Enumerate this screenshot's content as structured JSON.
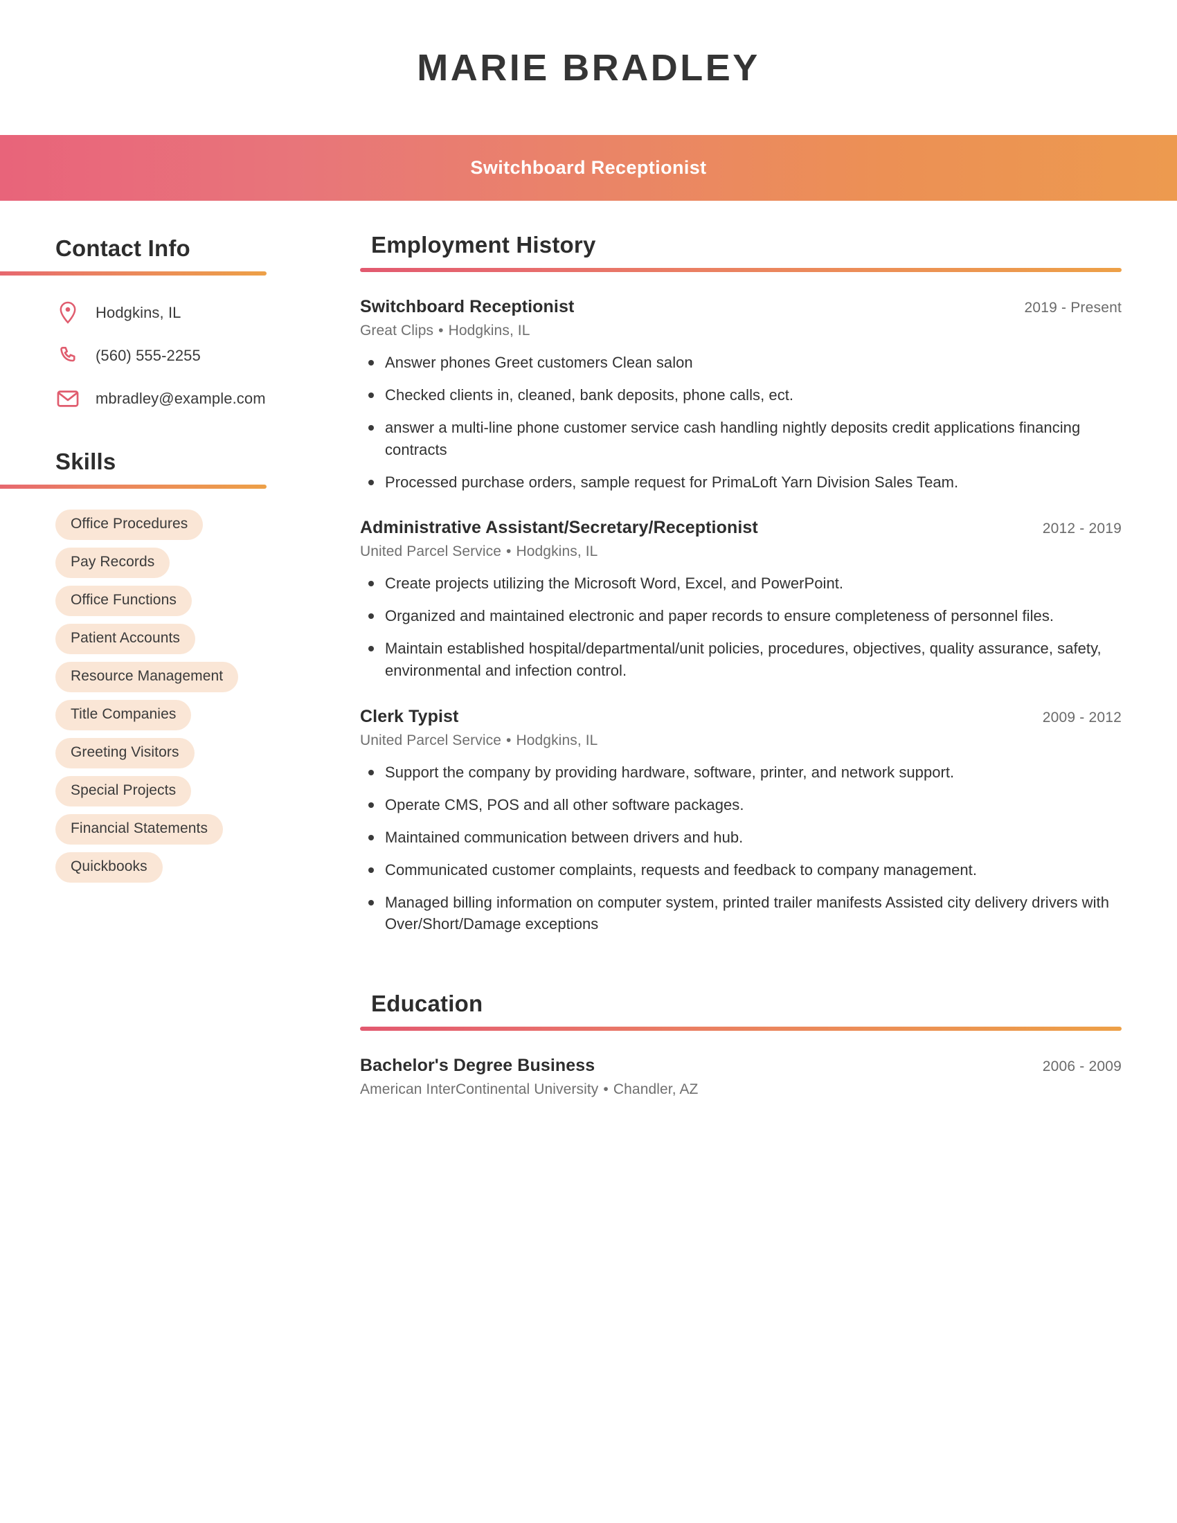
{
  "header": {
    "name": "MARIE BRADLEY",
    "job_title": "Switchboard Receptionist",
    "gradient_start": "#e8647a",
    "gradient_end": "#ed9a4f"
  },
  "sidebar": {
    "contact": {
      "heading": "Contact Info",
      "items": [
        {
          "icon": "location-pin-icon",
          "value": "Hodgkins, IL"
        },
        {
          "icon": "phone-icon",
          "value": "(560) 555-2255"
        },
        {
          "icon": "email-icon",
          "value": "mbradley@example.com"
        }
      ]
    },
    "skills": {
      "heading": "Skills",
      "items": [
        "Office Procedures",
        "Pay Records",
        "Office Functions",
        "Patient Accounts",
        "Resource Management",
        "Title Companies",
        "Greeting Visitors",
        "Special Projects",
        "Financial Statements",
        "Quickbooks"
      ],
      "pill_color": "#fae6d6"
    },
    "accent_color": "#e2596f"
  },
  "employment": {
    "heading": "Employment History",
    "entries": [
      {
        "title": "Switchboard Receptionist",
        "dates": "2019 - Present",
        "company": "Great Clips",
        "location": "Hodgkins, IL",
        "bullets": [
          "Answer phones Greet customers Clean salon",
          "Checked clients in, cleaned, bank deposits, phone calls, ect.",
          "answer a multi-line phone customer service cash handling nightly deposits credit applications financing contracts",
          "Processed purchase orders, sample request for PrimaLoft Yarn Division Sales Team."
        ]
      },
      {
        "title": "Administrative Assistant/Secretary/Receptionist",
        "dates": "2012 - 2019",
        "company": "United Parcel Service",
        "location": "Hodgkins, IL",
        "bullets": [
          "Create projects utilizing the Microsoft Word, Excel, and PowerPoint.",
          "Organized and maintained electronic and paper records to ensure completeness of personnel files.",
          "Maintain established hospital/departmental/unit policies, procedures, objectives, quality assurance, safety, environmental and infection control."
        ]
      },
      {
        "title": "Clerk Typist",
        "dates": "2009 - 2012",
        "company": "United Parcel Service",
        "location": "Hodgkins, IL",
        "bullets": [
          "Support the company by providing hardware, software, printer, and network support.",
          "Operate CMS, POS and all other software packages.",
          "Maintained communication between drivers and hub.",
          "Communicated customer complaints, requests and feedback to company management.",
          "Managed billing information on computer system, printed trailer manifests Assisted city delivery drivers with Over/Short/Damage exceptions"
        ]
      }
    ]
  },
  "education": {
    "heading": "Education",
    "entries": [
      {
        "degree": "Bachelor's Degree Business",
        "dates": "2006 - 2009",
        "school": "American InterContinental University",
        "location": "Chandler, AZ"
      }
    ]
  },
  "separator_bullet": "•"
}
